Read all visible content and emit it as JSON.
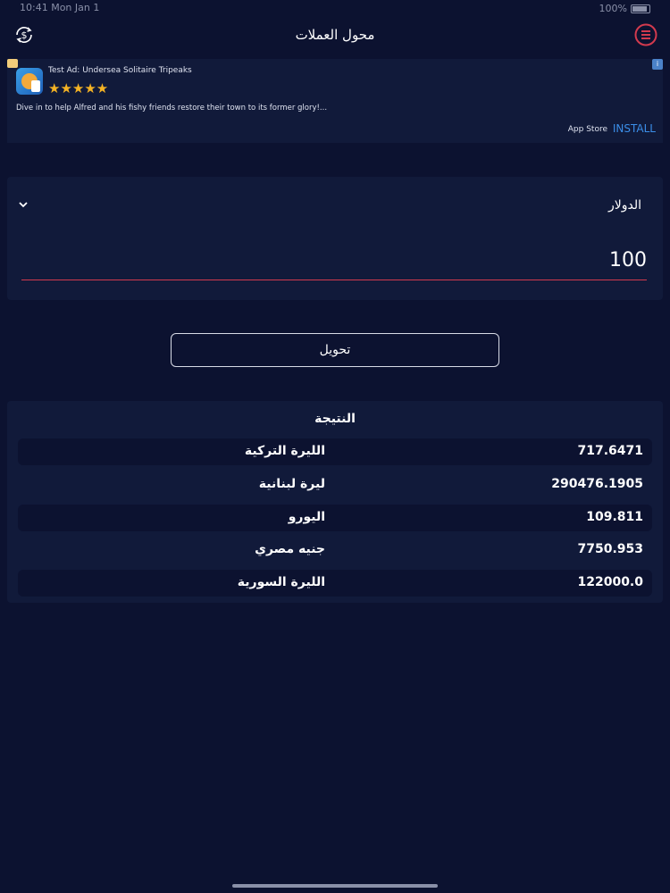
{
  "status_bar": {
    "left_text": "10:41  Mon Jan 1",
    "right_text": "100%"
  },
  "nav": {
    "title": "محول العملات"
  },
  "ad": {
    "title": "Test Ad: Undersea Solitaire Tripeaks",
    "stars": "★★★★★",
    "rating": 5,
    "description": "Dive in to help Alfred and his fishy friends restore their town to its former glory!...",
    "store": "App Store",
    "install_label": "INSTALL"
  },
  "converter": {
    "selected_currency": "الدولار",
    "amount": "100",
    "convert_label": "تحويل"
  },
  "results": {
    "title": "النتيجة",
    "rows": [
      {
        "name": "الليرة التركية",
        "value": "717.6471"
      },
      {
        "name": "ليرة لبنانية",
        "value": "290476.1905"
      },
      {
        "name": "اليورو",
        "value": "109.811"
      },
      {
        "name": "جنيه مصري",
        "value": "7750.953"
      },
      {
        "name": "الليرة السورية",
        "value": "122000.0"
      }
    ]
  },
  "colors": {
    "background": "#0c1230",
    "card": "#111a3a",
    "accent_red": "#d23a4e",
    "install_blue": "#3b8ee8",
    "star_gold": "#f5b324"
  }
}
